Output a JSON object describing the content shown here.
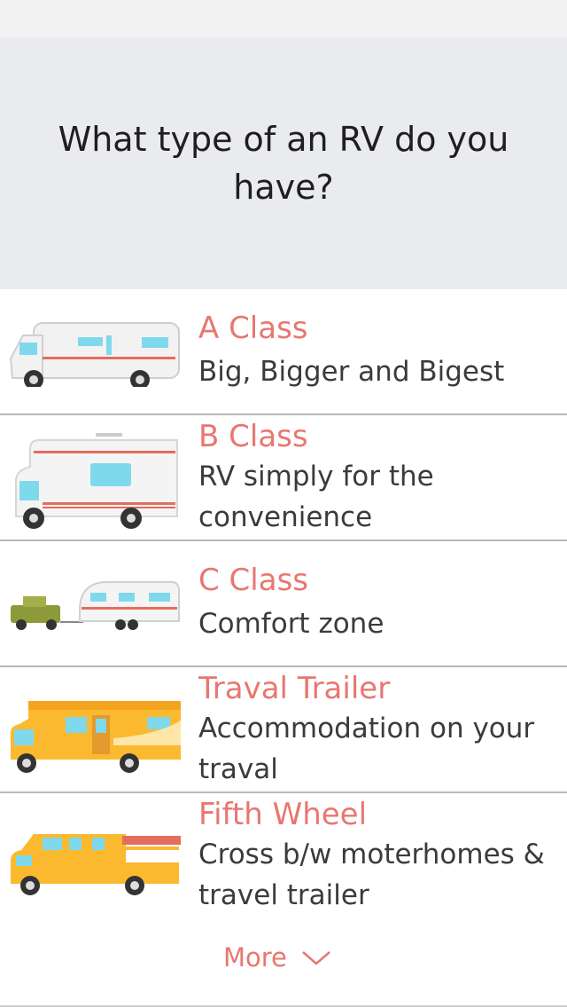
{
  "question": "What type of an RV do you have?",
  "options": [
    {
      "title": "A Class",
      "desc": "Big, Bigger and Bigest",
      "icon": "a-class-motorhome-icon"
    },
    {
      "title": "B Class",
      "desc": "RV simply for the convenience",
      "icon": "b-class-motorhome-icon"
    },
    {
      "title": "C Class",
      "desc": "Comfort zone",
      "icon": "jeep-with-camper-trailer-icon"
    },
    {
      "title": "Traval Trailer",
      "desc": "Accommodation on your traval",
      "icon": "yellow-motorhome-icon"
    },
    {
      "title": "Fifth Wheel",
      "desc": "Cross b/w moterhomes & travel trailer",
      "icon": "food-truck-icon"
    }
  ],
  "more_label": "More",
  "colors": {
    "accent": "#e8776f",
    "header_bg": "#eaebef",
    "divider": "#b9b9b9"
  }
}
